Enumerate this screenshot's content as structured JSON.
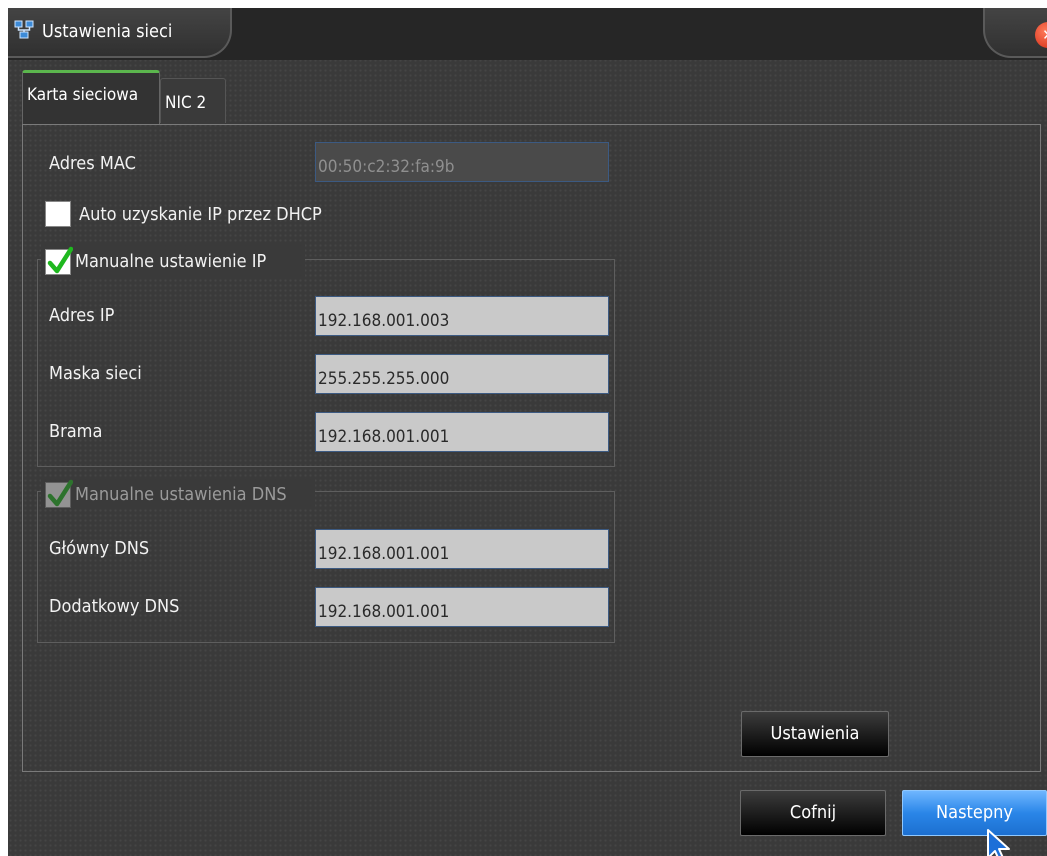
{
  "window": {
    "title": "Ustawienia sieci",
    "close_symbol": "✕"
  },
  "tabs": [
    {
      "label": "Karta sieciowa",
      "active": true
    },
    {
      "label": "NIC 2",
      "active": false
    }
  ],
  "mac": {
    "label": "Adres MAC",
    "value": "00:50:c2:32:fa:9b"
  },
  "dhcp": {
    "label": "Auto uzyskanie IP przez DHCP",
    "checked": false
  },
  "manual_ip": {
    "label": "Manualne ustawienie IP",
    "checked": true,
    "ip_label": "Adres IP",
    "ip_value": "192.168.001.003",
    "mask_label": "Maska sieci",
    "mask_value": "255.255.255.000",
    "gateway_label": "Brama",
    "gateway_value": "192.168.001.001"
  },
  "manual_dns": {
    "label": "Manualne ustawienia DNS",
    "checked": true,
    "disabled": true,
    "primary_label": "Główny DNS",
    "primary_value": "192.168.001.001",
    "secondary_label": "Dodatkowy DNS",
    "secondary_value": "192.168.001.001"
  },
  "buttons": {
    "settings": "Ustawienia",
    "back": "Cofnij",
    "next": "Nastepny"
  },
  "colors": {
    "accent": "#5bb64d",
    "primary_button": "#2a86e8",
    "checkmark": "#1fb81f"
  }
}
